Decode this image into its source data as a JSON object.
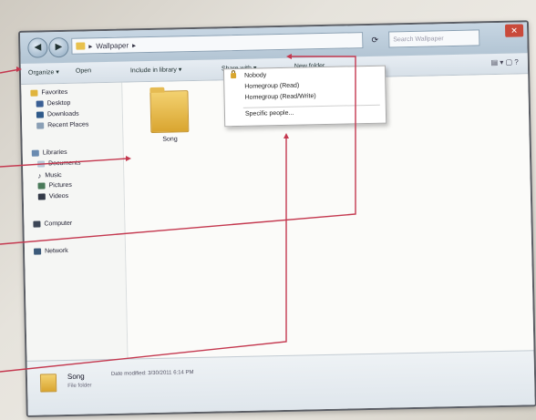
{
  "window": {
    "address_text": "Wallpaper",
    "search_placeholder": "Search Wallpaper"
  },
  "toolbar": {
    "organize": "Organize ▾",
    "open": "Open",
    "include_in_library": "Include in library ▾",
    "share_with": "Share with ▾",
    "new_folder": "New folder"
  },
  "nav": {
    "favorites": "Favorites",
    "desktop": "Desktop",
    "downloads": "Downloads",
    "recent_places": "Recent Places",
    "libraries": "Libraries",
    "documents": "Documents",
    "music": "Music",
    "pictures": "Pictures",
    "videos": "Videos",
    "computer": "Computer",
    "network": "Network"
  },
  "content": {
    "folder_name": "Song"
  },
  "share_menu": {
    "nobody": "Nobody",
    "homegroup_read": "Homegroup (Read)",
    "homegroup_readwrite": "Homegroup (Read/Write)",
    "specific_people": "Specific people..."
  },
  "details": {
    "name": "Song",
    "modified": "Date modified: 3/30/2011 6:14 PM",
    "type": "File folder"
  },
  "colors": {
    "callout_line": "#c4384f",
    "folder_yellow": "#e8c14d"
  }
}
